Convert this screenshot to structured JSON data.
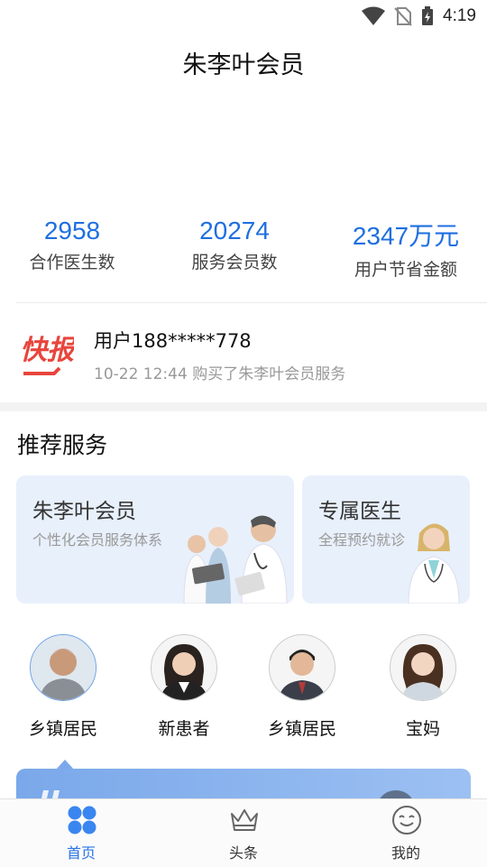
{
  "status_bar": {
    "time": "4:19"
  },
  "header": {
    "title": "朱李叶会员"
  },
  "stats": [
    {
      "value": "2958",
      "label": "合作医生数"
    },
    {
      "value": "20274",
      "label": "服务会员数"
    },
    {
      "value": "2347万元",
      "label": "用户节省金额"
    }
  ],
  "news": {
    "logo_text": "快报",
    "user": "用户188*****778",
    "detail": "10-22 12:44 购买了朱李叶会员服务"
  },
  "section": {
    "title": "推荐服务"
  },
  "services": [
    {
      "title": "朱李叶会员",
      "subtitle": "个性化会员服务体系"
    },
    {
      "title": "专属医生",
      "subtitle": "全程预约就诊"
    }
  ],
  "roles": [
    {
      "label": "乡镇居民"
    },
    {
      "label": "新患者"
    },
    {
      "label": "乡镇居民"
    },
    {
      "label": "宝妈"
    }
  ],
  "bottom_nav": [
    {
      "label": "首页",
      "icon": "home-grid-icon",
      "active": true
    },
    {
      "label": "头条",
      "icon": "crown-icon",
      "active": false
    },
    {
      "label": "我的",
      "icon": "smiley-icon",
      "active": false
    }
  ],
  "colors": {
    "accent": "#1e6fe0",
    "nav_active": "#2a74e6",
    "card_bg": "#e8f0fb",
    "news_red": "#e8453c"
  }
}
